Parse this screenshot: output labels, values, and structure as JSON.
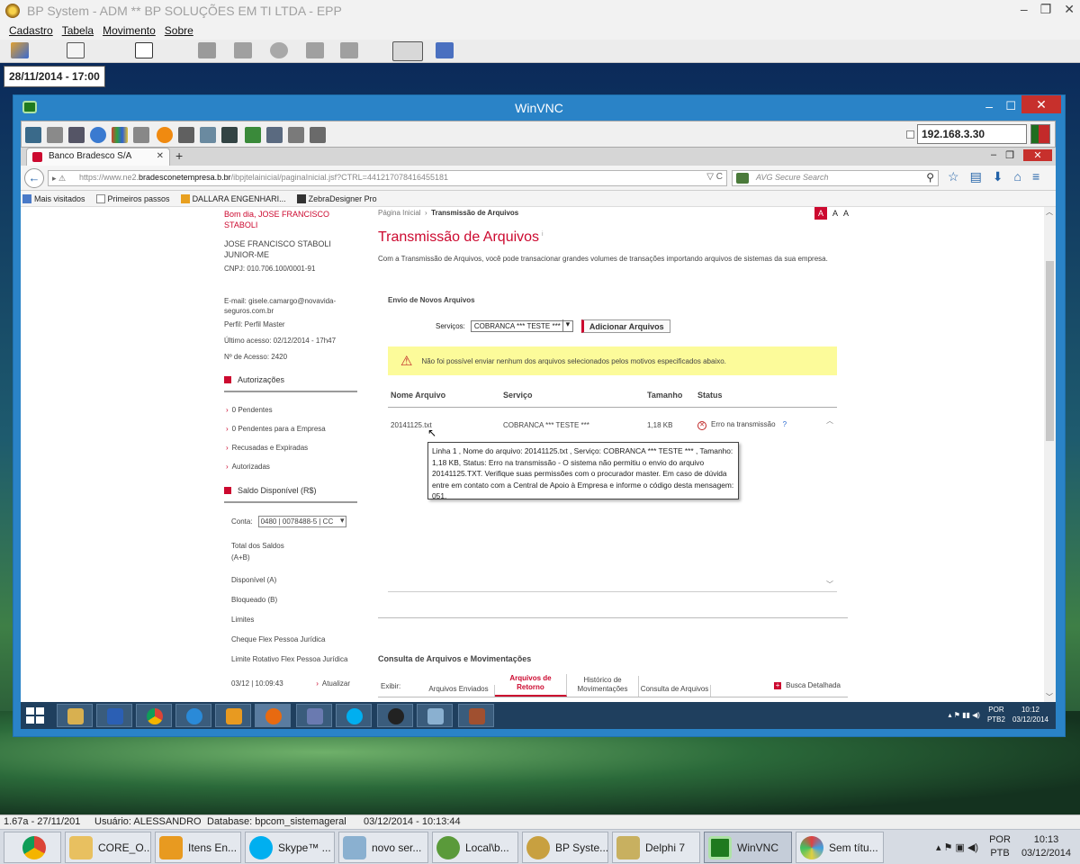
{
  "bp_window": {
    "title": "BP System - ADM ** BP SOLUÇÕES EM TI LTDA - EPP",
    "menu": [
      "Cadastro",
      "Tabela",
      "Movimento",
      "Sobre"
    ],
    "datetime": "28/11/2014 - 17:00",
    "status": {
      "version": "1.67a - 27/11/201",
      "user": "Usuário: ALESSANDRO",
      "database": "Database: bpcom_sistemageral",
      "datetime": "03/12/2014 - 10:13:44"
    }
  },
  "vnc": {
    "title": "WinVNC",
    "ip": "192.168.3.30"
  },
  "browser": {
    "tab_title": "Banco Bradesco S/A",
    "url_prefix": "https://www.ne2.",
    "url_host": "bradesconetempresa.b.br",
    "url_path": "/ibpjtelainicial/paginaInicial.jsf?CTRL=441217078416455181",
    "search_placeholder": "AVG Secure Search",
    "bookmarks": [
      "Mais visitados",
      "Primeiros passos",
      "DALLARA ENGENHARI...",
      "ZebraDesigner Pro"
    ]
  },
  "sidebar": {
    "greeting": "Bom dia,",
    "user_name": "JOSE FRANCISCO STABOLI",
    "company": "JOSE FRANCISCO STABOLI JUNIOR-ME",
    "cnpj": "CNPJ: 010.706.100/0001-91",
    "email": "E-mail: gisele.camargo@novavida-seguros.com.br",
    "perfil": "Perfil: Perfil Master",
    "ultimo_acesso": "Último acesso: 02/12/2014 - 17h47",
    "num_acesso": "Nº de Acesso: 2420",
    "autorizacoes_title": "Autorizações",
    "autorizacoes": [
      "0 Pendentes",
      "0 Pendentes para a Empresa",
      "Recusadas e Expiradas",
      "Autorizadas"
    ],
    "saldo_title": "Saldo Disponível (R$)",
    "conta_label": "Conta:",
    "conta_value": "0480 | 0078488-5 | CC",
    "saldo_lines": [
      "Total dos Saldos (A+B)",
      "Disponível (A)",
      "Bloqueado (B)",
      "Limites",
      "Cheque Flex Pessoa Jurídica",
      "Limite Rotativo Flex Pessoa Jurídica"
    ],
    "saldo_time": "03/12 | 10:09:43",
    "atualizar": "Atualizar"
  },
  "main": {
    "breadcrumb_home": "Página Inicial",
    "breadcrumb_current": "Transmissão de Arquivos",
    "font_small": "A",
    "font_mid": "A",
    "font_big": "A",
    "title": "Transmissão de Arquivos",
    "description": "Com a Transmissão de Arquivos, você pode transacionar grandes volumes de transações importando arquivos de sistemas da sua empresa.",
    "envio_title": "Envio de Novos Arquivos",
    "servicos_label": "Serviços:",
    "servico_value": "COBRANCA *** TESTE ***",
    "add_button": "Adicionar Arquivos",
    "warning": "Não foi possível enviar nenhum dos arquivos selecionados pelos motivos especificados abaixo.",
    "table": {
      "headers": [
        "Nome Arquivo",
        "Serviço",
        "Tamanho",
        "Status"
      ],
      "rows": [
        {
          "nome": "20141125.txt",
          "servico": "COBRANCA *** TESTE ***",
          "tamanho": "1,18 KB",
          "status": "Erro na transmissão",
          "help": "?"
        }
      ]
    },
    "tooltip": "Linha 1 , Nome do arquivo: 20141125.txt , Serviço: COBRANCA *** TESTE *** , Tamanho: 1,18 KB, Status: Erro na transmissão - O sistema não permitiu o envio do arquivo 20141125.TXT. Verifique suas permissões com o procurador master. Em caso de dúvida entre em contato com a Central de Apoio à Empresa e informe o código desta mensagem: 051.",
    "consulta_title": "Consulta de Arquivos e Movimentações",
    "exibir_label": "Exibir:",
    "tabs": [
      "Arquivos Enviados",
      "Arquivos de Retorno",
      "Histórico de Movimentações",
      "Consulta de Arquivos"
    ],
    "busca": "Busca Detalhada"
  },
  "remote_tray": {
    "lang": "POR",
    "layout": "PTB2",
    "time": "10:12",
    "date": "03/12/2014"
  },
  "taskbar": {
    "items": [
      {
        "label": "",
        "icon": "chrome-icon"
      },
      {
        "label": "CORE_O...",
        "icon": "folder-icon"
      },
      {
        "label": "Itens En...",
        "icon": "outlook-icon"
      },
      {
        "label": "Skype™ ...",
        "icon": "skype-icon"
      },
      {
        "label": "novo ser...",
        "icon": "notepad-icon"
      },
      {
        "label": "Local\\b...",
        "icon": "heidisql-icon"
      },
      {
        "label": "BP Syste...",
        "icon": "bp-system-icon"
      },
      {
        "label": "Delphi 7",
        "icon": "delphi-icon"
      },
      {
        "label": "WinVNC",
        "icon": "winvnc-icon"
      },
      {
        "label": "Sem títu...",
        "icon": "paint-icon"
      }
    ],
    "lang": "POR",
    "layout": "PTB",
    "time": "10:13",
    "date": "03/12/2014"
  }
}
